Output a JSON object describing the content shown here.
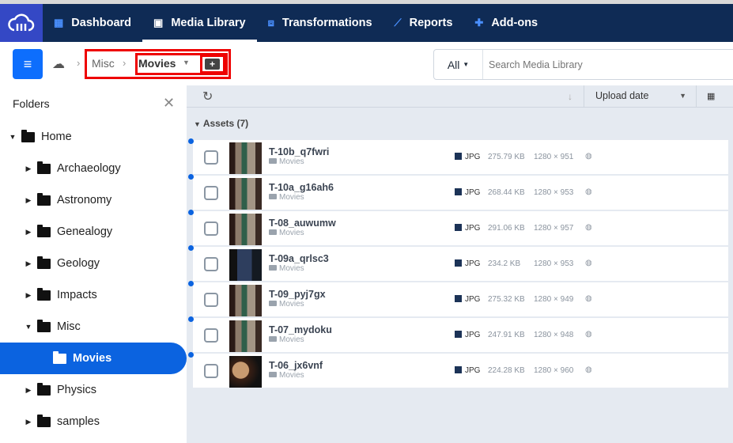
{
  "nav": {
    "items": [
      {
        "label": "Dashboard",
        "icon": "dashboard-icon"
      },
      {
        "label": "Media Library",
        "icon": "media-library-icon",
        "active": true
      },
      {
        "label": "Transformations",
        "icon": "transformations-icon"
      },
      {
        "label": "Reports",
        "icon": "reports-icon"
      },
      {
        "label": "Add-ons",
        "icon": "puzzle-icon"
      }
    ]
  },
  "breadcrumb": {
    "parent": "Misc",
    "current": "Movies",
    "separator": "›"
  },
  "search": {
    "filter": "All",
    "placeholder": "Search Media Library"
  },
  "sidebar": {
    "title": "Folders",
    "items": [
      {
        "label": "Home",
        "expanded": true
      },
      {
        "label": "Archaeology"
      },
      {
        "label": "Astronomy"
      },
      {
        "label": "Genealogy"
      },
      {
        "label": "Geology"
      },
      {
        "label": "Impacts"
      },
      {
        "label": "Misc",
        "expanded": true
      },
      {
        "label": "Movies",
        "selected": true
      },
      {
        "label": "Physics"
      },
      {
        "label": "samples"
      }
    ]
  },
  "list": {
    "sort_label": "Upload date",
    "assets_label": "Assets (7)",
    "rows": [
      {
        "name": "T-10b_q7fwri",
        "folder": "Movies",
        "type": "JPG",
        "size": "275.79 KB",
        "dims": "1280 × 951"
      },
      {
        "name": "T-10a_g16ah6",
        "folder": "Movies",
        "type": "JPG",
        "size": "268.44 KB",
        "dims": "1280 × 953"
      },
      {
        "name": "T-08_auwumw",
        "folder": "Movies",
        "type": "JPG",
        "size": "291.06 KB",
        "dims": "1280 × 957"
      },
      {
        "name": "T-09a_qrlsc3",
        "folder": "Movies",
        "type": "JPG",
        "size": "234.2 KB",
        "dims": "1280 × 953"
      },
      {
        "name": "T-09_pyj7gx",
        "folder": "Movies",
        "type": "JPG",
        "size": "275.32 KB",
        "dims": "1280 × 949"
      },
      {
        "name": "T-07_mydoku",
        "folder": "Movies",
        "type": "JPG",
        "size": "247.91 KB",
        "dims": "1280 × 948"
      },
      {
        "name": "T-06_jx6vnf",
        "folder": "Movies",
        "type": "JPG",
        "size": "224.28 KB",
        "dims": "1280 × 960"
      }
    ]
  },
  "colors": {
    "nav_bg": "#0f2b55",
    "accent": "#0b63e0",
    "logo_bg": "#3448c5",
    "highlight": "#e00000"
  }
}
